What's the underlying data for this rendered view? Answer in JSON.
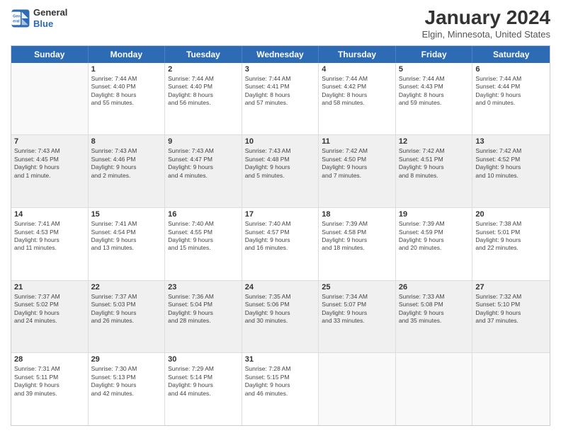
{
  "header": {
    "logo_line1": "General",
    "logo_line2": "Blue",
    "month_title": "January 2024",
    "location": "Elgin, Minnesota, United States"
  },
  "days_of_week": [
    "Sunday",
    "Monday",
    "Tuesday",
    "Wednesday",
    "Thursday",
    "Friday",
    "Saturday"
  ],
  "weeks": [
    [
      {
        "num": "",
        "lines": [],
        "empty": true
      },
      {
        "num": "1",
        "lines": [
          "Sunrise: 7:44 AM",
          "Sunset: 4:40 PM",
          "Daylight: 8 hours",
          "and 55 minutes."
        ]
      },
      {
        "num": "2",
        "lines": [
          "Sunrise: 7:44 AM",
          "Sunset: 4:40 PM",
          "Daylight: 8 hours",
          "and 56 minutes."
        ]
      },
      {
        "num": "3",
        "lines": [
          "Sunrise: 7:44 AM",
          "Sunset: 4:41 PM",
          "Daylight: 8 hours",
          "and 57 minutes."
        ]
      },
      {
        "num": "4",
        "lines": [
          "Sunrise: 7:44 AM",
          "Sunset: 4:42 PM",
          "Daylight: 8 hours",
          "and 58 minutes."
        ]
      },
      {
        "num": "5",
        "lines": [
          "Sunrise: 7:44 AM",
          "Sunset: 4:43 PM",
          "Daylight: 8 hours",
          "and 59 minutes."
        ]
      },
      {
        "num": "6",
        "lines": [
          "Sunrise: 7:44 AM",
          "Sunset: 4:44 PM",
          "Daylight: 9 hours",
          "and 0 minutes."
        ]
      }
    ],
    [
      {
        "num": "7",
        "lines": [
          "Sunrise: 7:43 AM",
          "Sunset: 4:45 PM",
          "Daylight: 9 hours",
          "and 1 minute."
        ],
        "shaded": true
      },
      {
        "num": "8",
        "lines": [
          "Sunrise: 7:43 AM",
          "Sunset: 4:46 PM",
          "Daylight: 9 hours",
          "and 2 minutes."
        ],
        "shaded": true
      },
      {
        "num": "9",
        "lines": [
          "Sunrise: 7:43 AM",
          "Sunset: 4:47 PM",
          "Daylight: 9 hours",
          "and 4 minutes."
        ],
        "shaded": true
      },
      {
        "num": "10",
        "lines": [
          "Sunrise: 7:43 AM",
          "Sunset: 4:48 PM",
          "Daylight: 9 hours",
          "and 5 minutes."
        ],
        "shaded": true
      },
      {
        "num": "11",
        "lines": [
          "Sunrise: 7:42 AM",
          "Sunset: 4:50 PM",
          "Daylight: 9 hours",
          "and 7 minutes."
        ],
        "shaded": true
      },
      {
        "num": "12",
        "lines": [
          "Sunrise: 7:42 AM",
          "Sunset: 4:51 PM",
          "Daylight: 9 hours",
          "and 8 minutes."
        ],
        "shaded": true
      },
      {
        "num": "13",
        "lines": [
          "Sunrise: 7:42 AM",
          "Sunset: 4:52 PM",
          "Daylight: 9 hours",
          "and 10 minutes."
        ],
        "shaded": true
      }
    ],
    [
      {
        "num": "14",
        "lines": [
          "Sunrise: 7:41 AM",
          "Sunset: 4:53 PM",
          "Daylight: 9 hours",
          "and 11 minutes."
        ]
      },
      {
        "num": "15",
        "lines": [
          "Sunrise: 7:41 AM",
          "Sunset: 4:54 PM",
          "Daylight: 9 hours",
          "and 13 minutes."
        ]
      },
      {
        "num": "16",
        "lines": [
          "Sunrise: 7:40 AM",
          "Sunset: 4:55 PM",
          "Daylight: 9 hours",
          "and 15 minutes."
        ]
      },
      {
        "num": "17",
        "lines": [
          "Sunrise: 7:40 AM",
          "Sunset: 4:57 PM",
          "Daylight: 9 hours",
          "and 16 minutes."
        ]
      },
      {
        "num": "18",
        "lines": [
          "Sunrise: 7:39 AM",
          "Sunset: 4:58 PM",
          "Daylight: 9 hours",
          "and 18 minutes."
        ]
      },
      {
        "num": "19",
        "lines": [
          "Sunrise: 7:39 AM",
          "Sunset: 4:59 PM",
          "Daylight: 9 hours",
          "and 20 minutes."
        ]
      },
      {
        "num": "20",
        "lines": [
          "Sunrise: 7:38 AM",
          "Sunset: 5:01 PM",
          "Daylight: 9 hours",
          "and 22 minutes."
        ]
      }
    ],
    [
      {
        "num": "21",
        "lines": [
          "Sunrise: 7:37 AM",
          "Sunset: 5:02 PM",
          "Daylight: 9 hours",
          "and 24 minutes."
        ],
        "shaded": true
      },
      {
        "num": "22",
        "lines": [
          "Sunrise: 7:37 AM",
          "Sunset: 5:03 PM",
          "Daylight: 9 hours",
          "and 26 minutes."
        ],
        "shaded": true
      },
      {
        "num": "23",
        "lines": [
          "Sunrise: 7:36 AM",
          "Sunset: 5:04 PM",
          "Daylight: 9 hours",
          "and 28 minutes."
        ],
        "shaded": true
      },
      {
        "num": "24",
        "lines": [
          "Sunrise: 7:35 AM",
          "Sunset: 5:06 PM",
          "Daylight: 9 hours",
          "and 30 minutes."
        ],
        "shaded": true
      },
      {
        "num": "25",
        "lines": [
          "Sunrise: 7:34 AM",
          "Sunset: 5:07 PM",
          "Daylight: 9 hours",
          "and 33 minutes."
        ],
        "shaded": true
      },
      {
        "num": "26",
        "lines": [
          "Sunrise: 7:33 AM",
          "Sunset: 5:08 PM",
          "Daylight: 9 hours",
          "and 35 minutes."
        ],
        "shaded": true
      },
      {
        "num": "27",
        "lines": [
          "Sunrise: 7:32 AM",
          "Sunset: 5:10 PM",
          "Daylight: 9 hours",
          "and 37 minutes."
        ],
        "shaded": true
      }
    ],
    [
      {
        "num": "28",
        "lines": [
          "Sunrise: 7:31 AM",
          "Sunset: 5:11 PM",
          "Daylight: 9 hours",
          "and 39 minutes."
        ]
      },
      {
        "num": "29",
        "lines": [
          "Sunrise: 7:30 AM",
          "Sunset: 5:13 PM",
          "Daylight: 9 hours",
          "and 42 minutes."
        ]
      },
      {
        "num": "30",
        "lines": [
          "Sunrise: 7:29 AM",
          "Sunset: 5:14 PM",
          "Daylight: 9 hours",
          "and 44 minutes."
        ]
      },
      {
        "num": "31",
        "lines": [
          "Sunrise: 7:28 AM",
          "Sunset: 5:15 PM",
          "Daylight: 9 hours",
          "and 46 minutes."
        ]
      },
      {
        "num": "",
        "lines": [],
        "empty": true
      },
      {
        "num": "",
        "lines": [],
        "empty": true
      },
      {
        "num": "",
        "lines": [],
        "empty": true
      }
    ]
  ]
}
